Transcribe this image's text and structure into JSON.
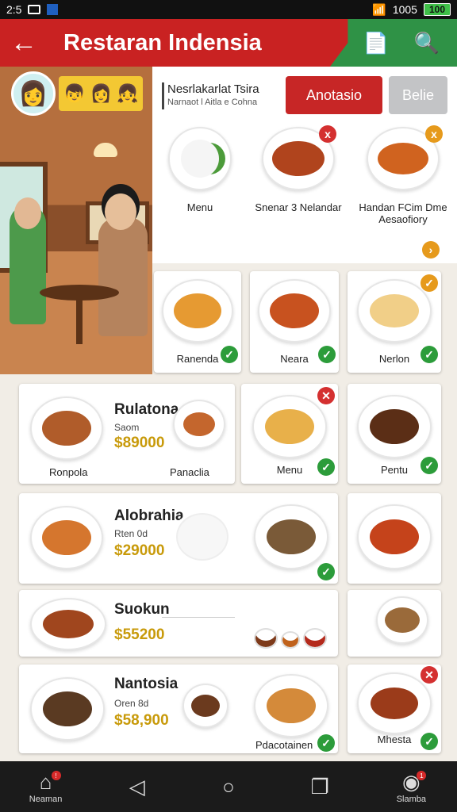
{
  "status_bar": {
    "time": "2:5",
    "battery": "100",
    "signal": "1005"
  },
  "header": {
    "title": "Restaran Indensia",
    "back_icon": "arrow-left-icon",
    "icons": [
      "document-icon",
      "search-icon"
    ]
  },
  "search": {
    "label": "Nesrlakarlat Tsira",
    "sub": "Narnaot l Aitla e Cohna"
  },
  "buttons": {
    "primary": "Anotasio",
    "secondary": "Belie"
  },
  "categories": [
    {
      "label": "Menu",
      "badge": ""
    },
    {
      "label": "Snenar 3 Nelandar",
      "badge": "x"
    },
    {
      "label": "Handan FCim Dme Aesaofiory",
      "badge": "x"
    }
  ],
  "row1": [
    {
      "name": "Ranenda"
    },
    {
      "name": "Neara"
    },
    {
      "name": "Nerlon"
    }
  ],
  "featured": [
    {
      "title": "Rulatona",
      "sub": "Saom",
      "price": "$89000",
      "caption1": "Ronpola",
      "caption2": "Panaclia"
    },
    {
      "title": "Alobrahia",
      "sub": "Rten 0d",
      "price": "$29000"
    },
    {
      "title": "Suokun",
      "sub": "",
      "price": "$55200"
    },
    {
      "title": "Nantosia",
      "sub": "Oren 8d",
      "price": "$58,900",
      "caption2": "Pdacotainen"
    }
  ],
  "right_cards": [
    {
      "name": "Menu"
    },
    {
      "name": "Pentu"
    },
    {
      "name": ""
    },
    {
      "name": ""
    },
    {
      "name": "Mhesta"
    }
  ],
  "nav": {
    "home": "Neaman",
    "right": "Slamba",
    "home_badge": "!",
    "right_badge": "1"
  }
}
